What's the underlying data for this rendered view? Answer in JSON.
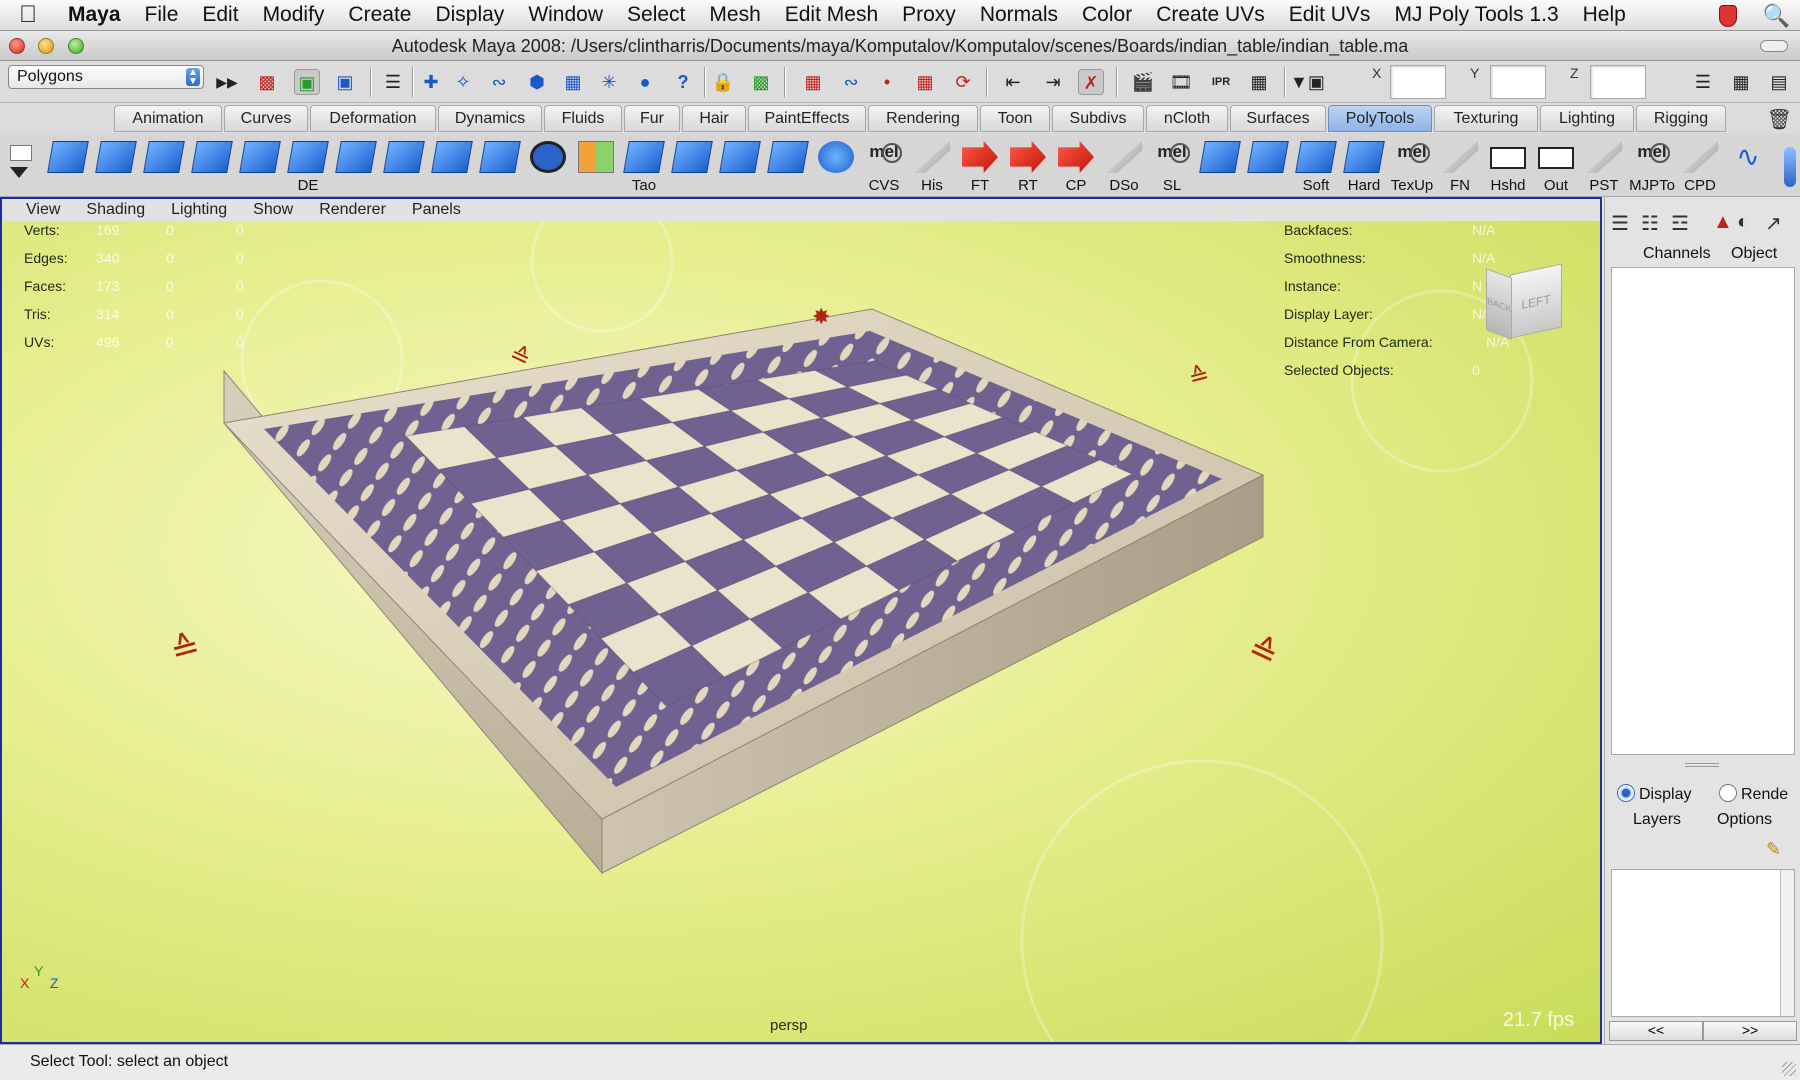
{
  "menubar": {
    "app": "Maya",
    "items": [
      "File",
      "Edit",
      "Modify",
      "Create",
      "Display",
      "Window",
      "Select",
      "Mesh",
      "Edit Mesh",
      "Proxy",
      "Normals",
      "Color",
      "Create UVs",
      "Edit UVs",
      "MJ Poly Tools 1.3",
      "Help"
    ]
  },
  "window": {
    "title": "Autodesk Maya 2008: /Users/clintharris/Documents/maya/Komputalov/Komputalov/scenes/Boards/indian_table/indian_table.ma"
  },
  "statusline": {
    "mode": "Polygons",
    "x_label": "X",
    "y_label": "Y",
    "z_label": "Z",
    "x_value": "",
    "y_value": "",
    "z_value": ""
  },
  "shelf_tabs": {
    "items": [
      "Animation",
      "Curves",
      "Deformation",
      "Dynamics",
      "Fluids",
      "Fur",
      "Hair",
      "PaintEffects",
      "Rendering",
      "Toon",
      "Subdivs",
      "nCloth",
      "Surfaces",
      "PolyTools",
      "Texturing",
      "Lighting",
      "Rigging"
    ],
    "active": "PolyTools"
  },
  "shelf": {
    "labels": [
      "DE",
      "Tao",
      "CVS",
      "His",
      "FT",
      "RT",
      "CP",
      "DSo",
      "SL",
      "Soft",
      "Hard",
      "TexUp",
      "FN",
      "Hshd",
      "Out",
      "PST",
      "MJPTo",
      "CPD"
    ]
  },
  "panel_menu": [
    "View",
    "Shading",
    "Lighting",
    "Show",
    "Renderer",
    "Panels"
  ],
  "hud_left": {
    "rows": [
      {
        "label": "Verts:",
        "v1": "169",
        "v2": "0",
        "v3": "0"
      },
      {
        "label": "Edges:",
        "v1": "340",
        "v2": "0",
        "v3": "0"
      },
      {
        "label": "Faces:",
        "v1": "173",
        "v2": "0",
        "v3": "0"
      },
      {
        "label": "Tris:",
        "v1": "314",
        "v2": "0",
        "v3": "0"
      },
      {
        "label": "UVs:",
        "v1": "496",
        "v2": "0",
        "v3": "0"
      }
    ]
  },
  "hud_right": {
    "rows": [
      {
        "label": "Backfaces:",
        "value": "N/A"
      },
      {
        "label": "Smoothness:",
        "value": "N/A"
      },
      {
        "label": "Instance:",
        "value": "N"
      },
      {
        "label": "Display Layer:",
        "value": "N/A"
      },
      {
        "label": "Distance From Camera:",
        "value": "N/A"
      },
      {
        "label": "Selected Objects:",
        "value": "0"
      }
    ]
  },
  "viewcube": {
    "face_left": "LEFT",
    "face_back": "BACK"
  },
  "viewport": {
    "camera": "persp",
    "fps": "21.7 fps",
    "axis_x": "X",
    "axis_y": "Y",
    "axis_z": "Z"
  },
  "right_panel": {
    "tab_channels": "Channels",
    "tab_object": "Object",
    "radio_display": "Display",
    "radio_render": "Rende",
    "layers_label": "Layers",
    "options_label": "Options",
    "prev": "<<",
    "next": ">>"
  },
  "helpline": {
    "text": "Select Tool: select an object"
  },
  "colors": {
    "board_purple": "#6f6290",
    "board_cream": "#ece3cc",
    "frame_stone": "#d6cbb7",
    "viewport_bg": "#e6ee8e",
    "active_tab": "#9bbbe9"
  }
}
